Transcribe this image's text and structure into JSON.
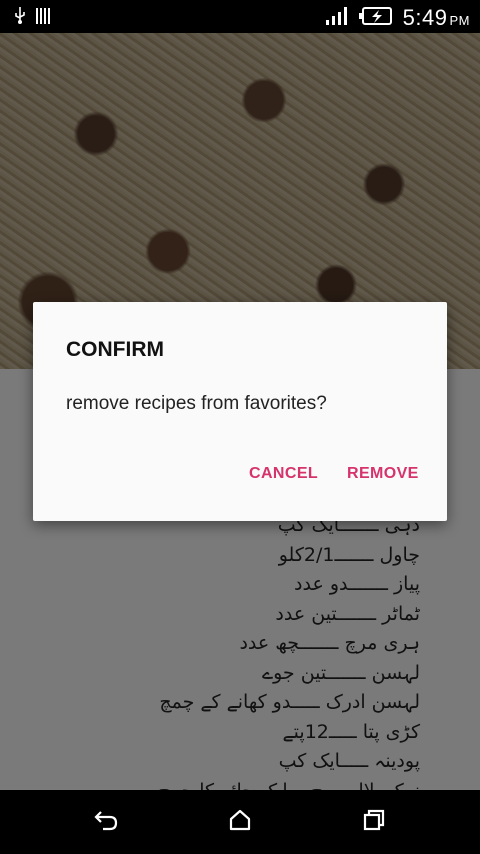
{
  "status_bar": {
    "time": "5:49",
    "ampm": "PM",
    "icons": [
      "usb-icon",
      "notification-bars-icon",
      "signal-icon",
      "battery-charging-icon"
    ]
  },
  "recipe": {
    "ingredients": [
      "دہی ـــــــایک کپ",
      "چاول ـــــــ2/1کلو",
      "پیاز ـــــــدو عدد",
      "ٹماٹر ـــــــتین عدد",
      "ہری مرچ ـــــــچھ عدد",
      "لہسن ـــــــتین جوے",
      "لہسن ادرک ـــــدو کھانے کے چمچ",
      "کڑی پتا ـــــ12پتے",
      "پودینہ ـــــایک کپ",
      "نمک ،لال مرچ ـــایک چائے کا چمچ"
    ]
  },
  "dialog": {
    "title": "CONFIRM",
    "message": "remove recipes from favorites?",
    "cancel_label": "CANCEL",
    "confirm_label": "REMOVE",
    "accent_color": "#d6336c"
  },
  "nav_bar": {
    "icons": [
      "back-icon",
      "home-icon",
      "recents-icon"
    ]
  }
}
